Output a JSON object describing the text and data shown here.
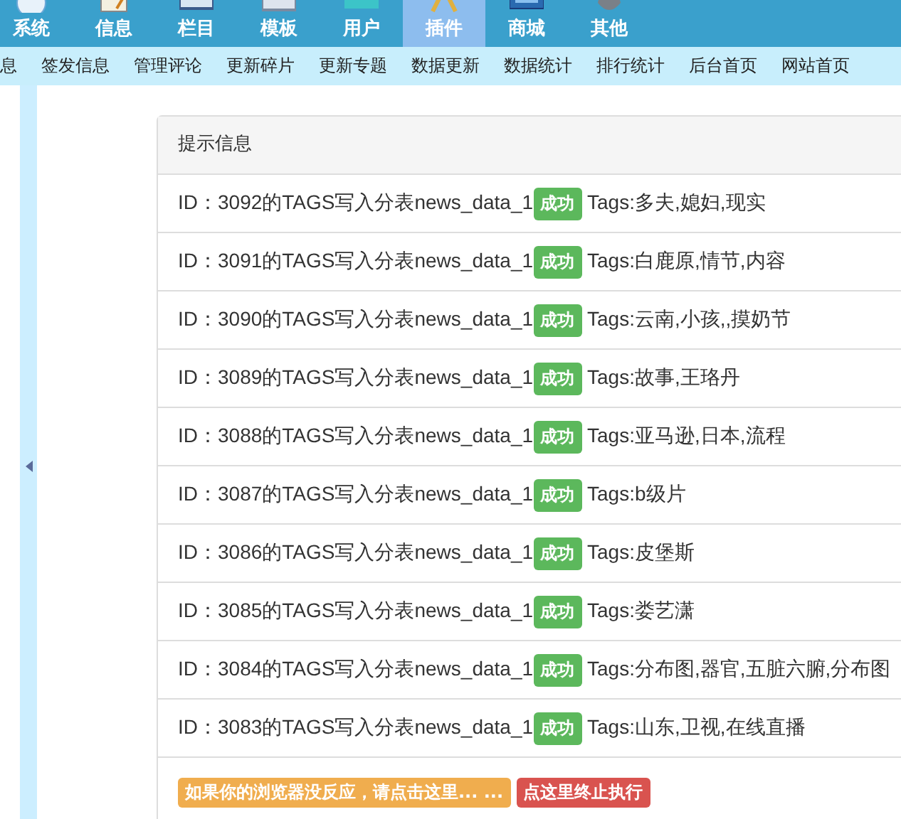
{
  "top_nav": [
    {
      "label": "系统",
      "selected": false
    },
    {
      "label": "信息",
      "selected": false
    },
    {
      "label": "栏目",
      "selected": false
    },
    {
      "label": "模板",
      "selected": false
    },
    {
      "label": "用户",
      "selected": false
    },
    {
      "label": "插件",
      "selected": true
    },
    {
      "label": "商城",
      "selected": false
    },
    {
      "label": "其他",
      "selected": false
    }
  ],
  "sub_nav": [
    "息",
    "签发信息",
    "管理评论",
    "更新碎片",
    "更新专题",
    "数据更新",
    "数据统计",
    "排行统计",
    "后台首页",
    "网站首页"
  ],
  "panel": {
    "title": "提示信息",
    "rows": [
      {
        "text": "ID：3092的TAGS写入分表news_data_1",
        "status": "成功",
        "tags": "Tags:多夫,媳妇,现实"
      },
      {
        "text": "ID：3091的TAGS写入分表news_data_1",
        "status": "成功",
        "tags": "Tags:白鹿原,情节,内容"
      },
      {
        "text": "ID：3090的TAGS写入分表news_data_1",
        "status": "成功",
        "tags": "Tags:云南,小孩,,摸奶节"
      },
      {
        "text": "ID：3089的TAGS写入分表news_data_1",
        "status": "成功",
        "tags": "Tags:故事,王珞丹"
      },
      {
        "text": "ID：3088的TAGS写入分表news_data_1",
        "status": "成功",
        "tags": "Tags:亚马逊,日本,流程"
      },
      {
        "text": "ID：3087的TAGS写入分表news_data_1",
        "status": "成功",
        "tags": "Tags:b级片"
      },
      {
        "text": "ID：3086的TAGS写入分表news_data_1",
        "status": "成功",
        "tags": "Tags:皮堡斯"
      },
      {
        "text": "ID：3085的TAGS写入分表news_data_1",
        "status": "成功",
        "tags": "Tags:娄艺潇"
      },
      {
        "text": "ID：3084的TAGS写入分表news_data_1",
        "status": "成功",
        "tags": "Tags:分布图,器官,五脏六腑,分布图"
      },
      {
        "text": "ID：3083的TAGS写入分表news_data_1",
        "status": "成功",
        "tags": "Tags:山东,卫视,在线直播"
      }
    ],
    "buttons": [
      {
        "label": "如果你的浏览器没反应，请点击这里... ...",
        "kind": "warning"
      },
      {
        "label": "点这里终止执行",
        "kind": "danger"
      }
    ]
  }
}
